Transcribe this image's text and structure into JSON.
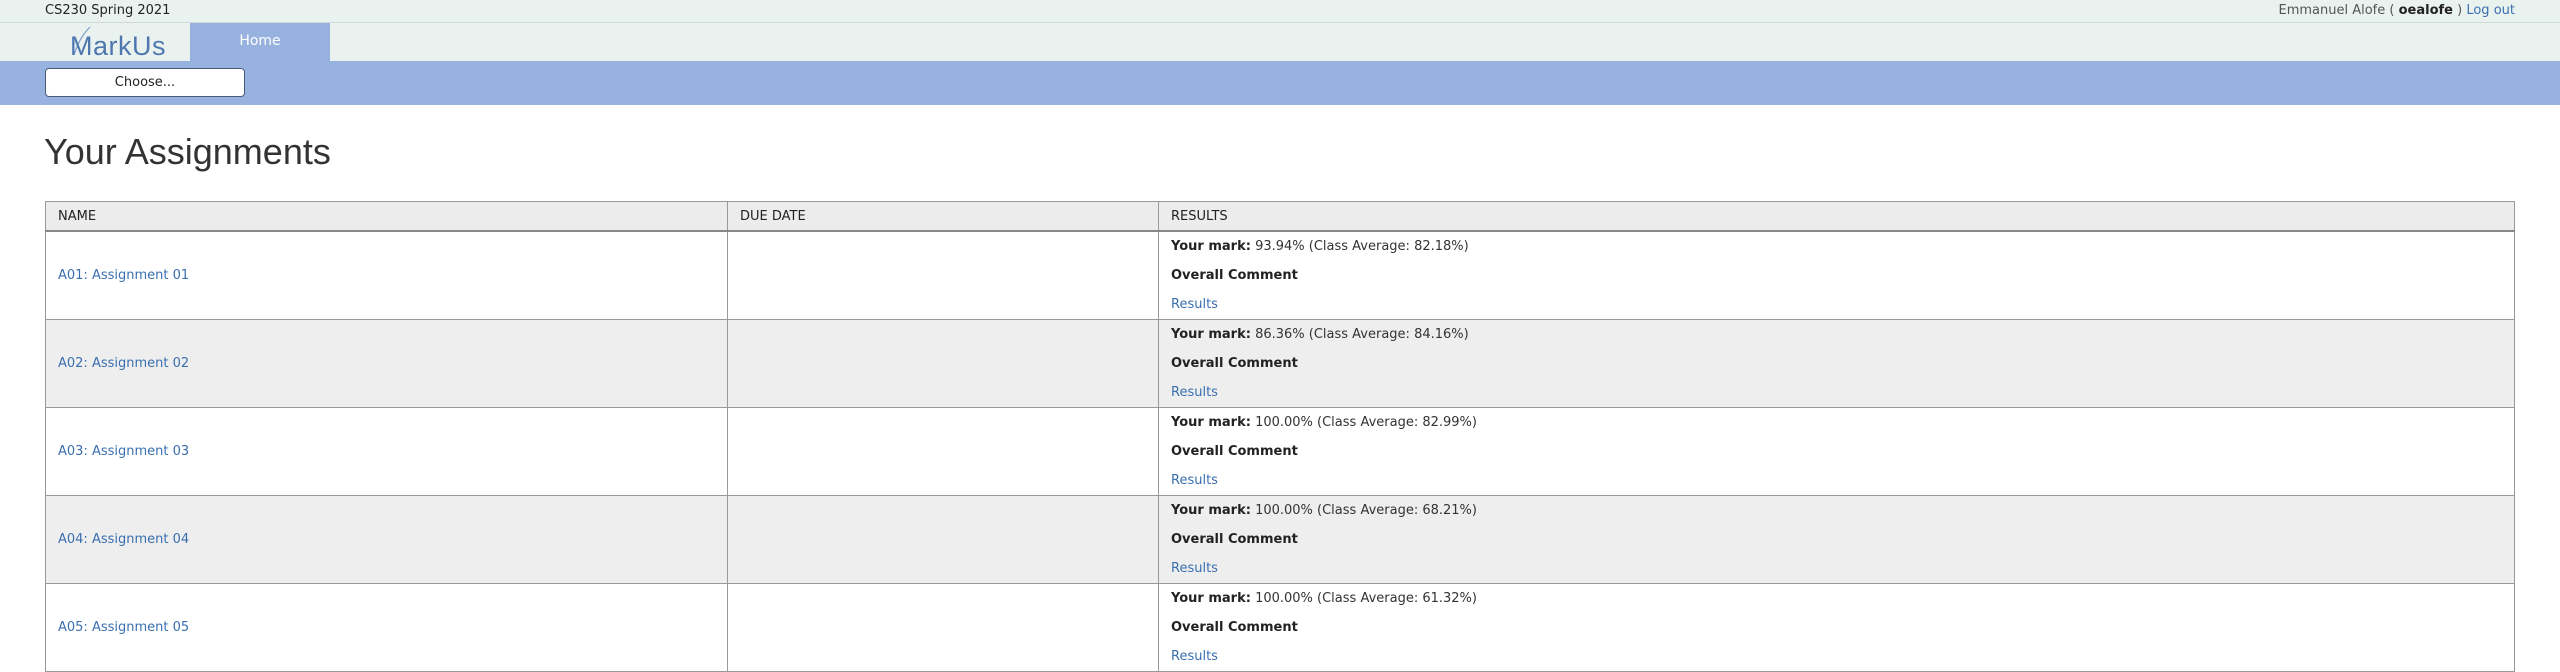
{
  "header": {
    "course": "CS230 Spring 2021",
    "user_prefix": "Emmanuel Alofe (",
    "username": "oealofe",
    "user_suffix": ")",
    "logout": "Log out"
  },
  "nav": {
    "logo": "MarkUs",
    "home_tab": "Home"
  },
  "subnav": {
    "choose_button": "Choose..."
  },
  "page_title": "Your Assignments",
  "table": {
    "columns": [
      "NAME",
      "DUE DATE",
      "RESULTS"
    ],
    "mark_label": "Your mark:",
    "comment_label": "Overall Comment",
    "results_link": "Results",
    "rows": [
      {
        "name": "A01: Assignment 01",
        "due": "",
        "mark": "93.94% (Class Average: 82.18%)"
      },
      {
        "name": "A02: Assignment 02",
        "due": "",
        "mark": "86.36% (Class Average: 84.16%)"
      },
      {
        "name": "A03: Assignment 03",
        "due": "",
        "mark": "100.00% (Class Average: 82.99%)"
      },
      {
        "name": "A04: Assignment 04",
        "due": "",
        "mark": "100.00% (Class Average: 68.21%)"
      },
      {
        "name": "A05: Assignment 05",
        "due": "",
        "mark": "100.00% (Class Average: 61.32%)"
      }
    ]
  }
}
